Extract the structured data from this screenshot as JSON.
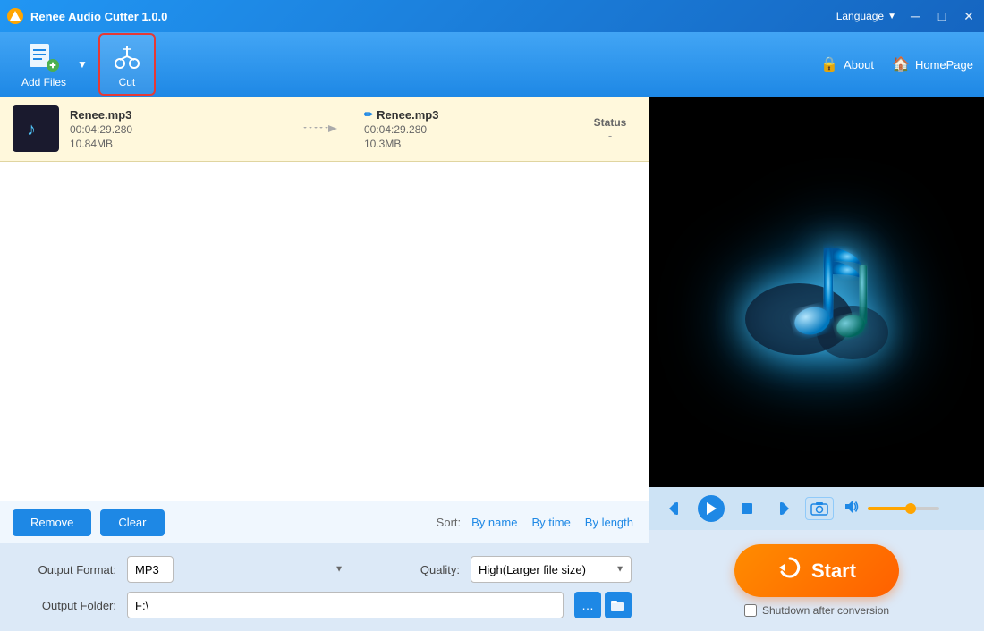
{
  "titleBar": {
    "appName": "Renee Audio Cutter 1.0.0",
    "language": "Language",
    "minBtn": "─",
    "maxBtn": "□",
    "closeBtn": "✕"
  },
  "toolbar": {
    "addFilesLabel": "Add Files",
    "cutLabel": "Cut",
    "aboutLabel": "About",
    "homePageLabel": "HomePage"
  },
  "fileList": {
    "columns": {
      "status": "Status"
    },
    "files": [
      {
        "name": "Renee.mp3",
        "duration": "00:04:29.280",
        "size": "10.84MB",
        "outputName": "Renee.mp3",
        "outputDuration": "00:04:29.280",
        "outputSize": "10.3MB",
        "status": "-"
      }
    ]
  },
  "controls": {
    "removeLabel": "Remove",
    "clearLabel": "Clear",
    "sortLabel": "Sort:",
    "sortByName": "By name",
    "sortByTime": "By time",
    "sortByLength": "By length"
  },
  "outputOptions": {
    "formatLabel": "Output Format:",
    "formatValue": "MP3",
    "qualityLabel": "Quality:",
    "qualityValue": "High(Larger file size)",
    "folderLabel": "Output Folder:",
    "folderValue": "F:\\"
  },
  "player": {
    "volumePercent": 60
  },
  "startBtn": {
    "label": "Start",
    "shutdownLabel": "Shutdown after conversion"
  },
  "icons": {
    "music": "♪",
    "addFiles": "➕",
    "cut": "✂",
    "about": "🔒",
    "home": "🏠",
    "arrow": "⟶",
    "edit": "✏",
    "prevTrack": "⏮",
    "play": "▶",
    "stop": "■",
    "nextTrack": "⏭",
    "camera": "📷",
    "volume": "🔊",
    "folder": "📁",
    "browse": "…",
    "refresh": "🔄"
  }
}
